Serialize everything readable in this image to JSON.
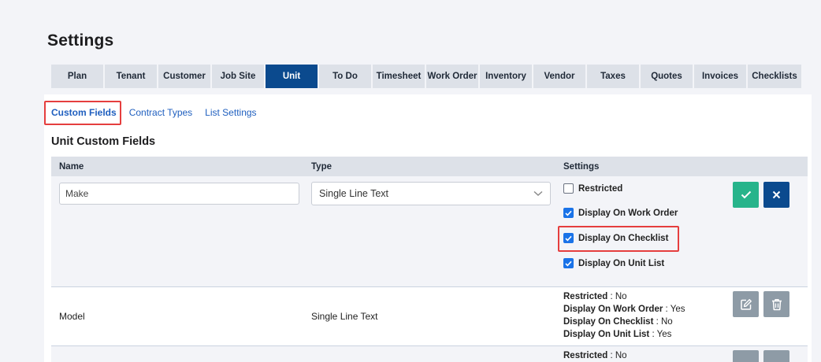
{
  "page": {
    "title": "Settings"
  },
  "tabs": [
    {
      "label": "Plan",
      "active": false
    },
    {
      "label": "Tenant",
      "active": false
    },
    {
      "label": "Customer",
      "active": false
    },
    {
      "label": "Job Site",
      "active": false
    },
    {
      "label": "Unit",
      "active": true
    },
    {
      "label": "To Do",
      "active": false
    },
    {
      "label": "Timesheet",
      "active": false
    },
    {
      "label": "Work Order",
      "active": false
    },
    {
      "label": "Inventory",
      "active": false
    },
    {
      "label": "Vendor",
      "active": false
    },
    {
      "label": "Taxes",
      "active": false
    },
    {
      "label": "Quotes",
      "active": false
    },
    {
      "label": "Invoices",
      "active": false
    },
    {
      "label": "Checklists",
      "active": false
    }
  ],
  "subtabs": [
    {
      "label": "Custom Fields",
      "active": true
    },
    {
      "label": "Contract Types",
      "active": false
    },
    {
      "label": "List Settings",
      "active": false
    }
  ],
  "section": {
    "title": "Unit Custom Fields"
  },
  "table": {
    "headers": {
      "name": "Name",
      "type": "Type",
      "settings": "Settings"
    },
    "edit_row": {
      "name_value": "Make",
      "type_value": "Single Line Text",
      "checks": [
        {
          "label": "Restricted",
          "checked": false
        },
        {
          "label": "Display On Work Order",
          "checked": true
        },
        {
          "label": "Display On Checklist",
          "checked": true
        },
        {
          "label": "Display On Unit List",
          "checked": true
        }
      ]
    },
    "rows": [
      {
        "name": "Model",
        "type": "Single Line Text",
        "details": [
          {
            "label": "Restricted",
            "value": "No"
          },
          {
            "label": "Display On Work Order",
            "value": "Yes"
          },
          {
            "label": "Display On Checklist",
            "value": "No"
          },
          {
            "label": "Display On Unit List",
            "value": "Yes"
          }
        ]
      },
      {
        "details": [
          {
            "label": "Restricted",
            "value": "No"
          }
        ]
      }
    ]
  },
  "colors": {
    "active_tab": "#0b4a8e",
    "save_button": "#27b48b",
    "cancel_button": "#0b4a8e",
    "checkbox": "#1a73e8",
    "highlight": "#e53e3e",
    "icon_button": "#8e9ba6"
  }
}
